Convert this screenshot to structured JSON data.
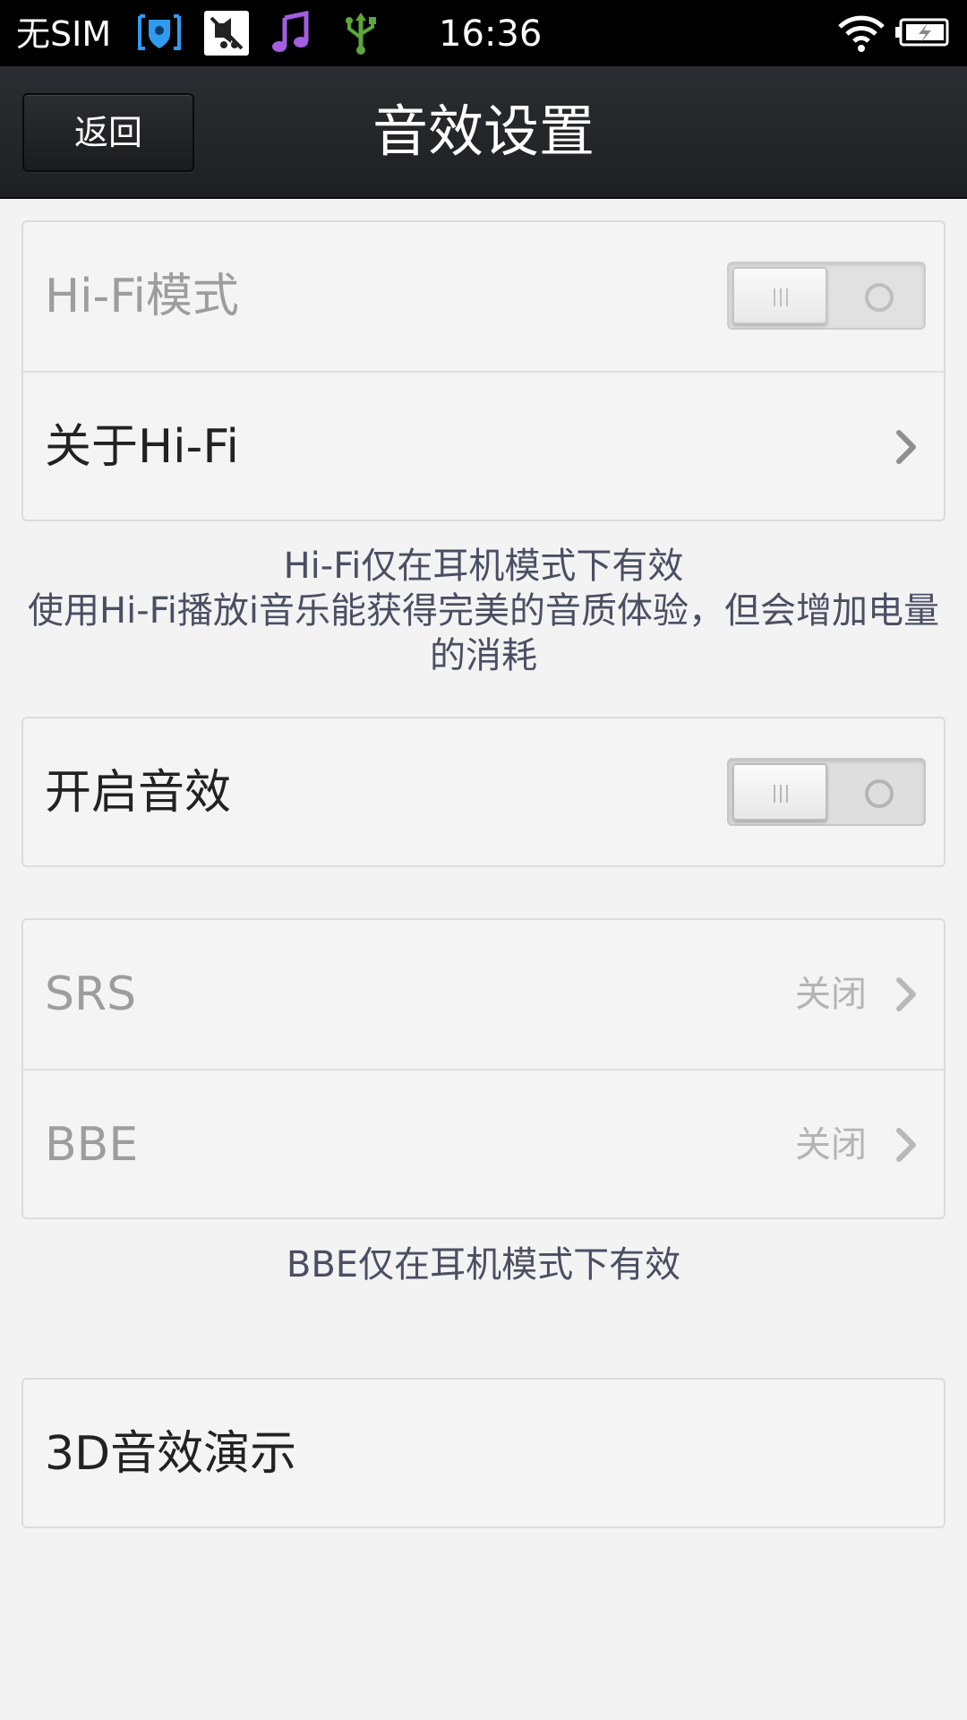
{
  "status_bar": {
    "carrier": "无SIM",
    "time": "16:36",
    "icons": [
      "headset-notification-icon",
      "muted-app-icon",
      "music-icon",
      "usb-icon",
      "wifi-icon",
      "battery-charging-icon"
    ]
  },
  "header": {
    "back_label": "返回",
    "title": "音效设置"
  },
  "hifi_section": {
    "mode_label": "Hi-Fi模式",
    "mode_enabled": false,
    "about_label": "关于Hi-Fi",
    "note_line1": "Hi-Fi仅在耳机模式下有效",
    "note_line2": "使用Hi-Fi播放i音乐能获得完美的音质体验，但会增加电量的消耗"
  },
  "effects_section": {
    "enable_label": "开启音效",
    "enable_on": false
  },
  "enhancers": {
    "srs_label": "SRS",
    "srs_value": "关闭",
    "bbe_label": "BBE",
    "bbe_value": "关闭",
    "note": "BBE仅在耳机模式下有效"
  },
  "demo": {
    "label": "3D音效演示"
  },
  "colors": {
    "status_bar_bg": "#000000",
    "title_bar_bg": "#232428",
    "page_bg": "#f3f3f3",
    "help_text": "#4a4f63",
    "disabled_text": "#9d9d9d"
  }
}
